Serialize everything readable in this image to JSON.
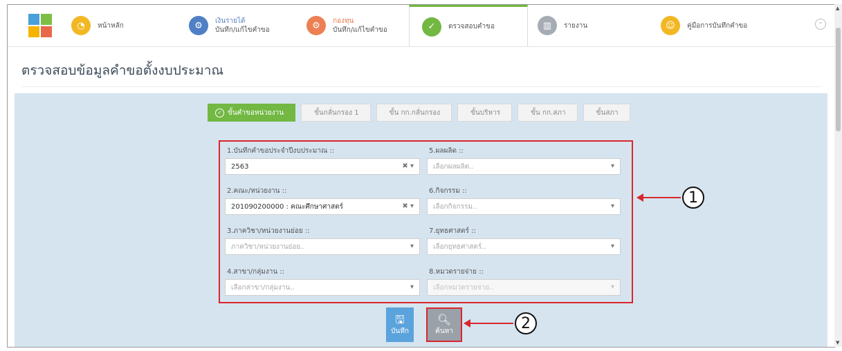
{
  "nav": {
    "items": [
      {
        "line1": "หน้าหลัก",
        "line2": ""
      },
      {
        "line1": "เงินรายได้",
        "line2": "บันทึก/แก้ไขคำขอ"
      },
      {
        "line1": "กองทุน",
        "line2": "บันทึก/แก้ไขคำขอ"
      },
      {
        "line1": "ตรวจสอบคำขอ",
        "line2": ""
      },
      {
        "line1": "รายงาน",
        "line2": ""
      },
      {
        "line1": "คู่มือการบันทึกคำขอ",
        "line2": ""
      }
    ],
    "collapse_glyph": "⌃"
  },
  "page": {
    "title": "ตรวจสอบข้อมูลคำขอตั้งงบประมาณ"
  },
  "steps": [
    "ขั้นคำขอหน่วยงาน",
    "ขั้นกลั่นกรอง 1",
    "ขั้น กก.กลั่นกรอง",
    "ขั้นบริหาร",
    "ขั้น กก.สภา",
    "ขั้นสภา"
  ],
  "form": {
    "f1": {
      "label": "1.บันทึกคำขอประจำปีงบประมาณ ::",
      "value": "2563"
    },
    "f2": {
      "label": "2.คณะ/หน่วยงาน ::",
      "value": "201090200000 : คณะศึกษาศาสตร์"
    },
    "f3": {
      "label": "3.ภาควิชา/หน่วยงานย่อย ::",
      "placeholder": "ภาควิชา/หน่วยงานย่อย.."
    },
    "f4": {
      "label": "4.สาขา/กลุ่มงาน ::",
      "placeholder": "เลือกสาขา/กลุ่มงาน.."
    },
    "f5": {
      "label": "5.ผลผลิต ::",
      "placeholder": "เลือกผลผลิต.."
    },
    "f6": {
      "label": "6.กิจกรรม ::",
      "placeholder": "เลือกกิจกรรม.."
    },
    "f7": {
      "label": "7.ยุทธศาสตร์ ::",
      "placeholder": "เลือกยุทธศาสตร์.."
    },
    "f8": {
      "label": "8.หมวดรายจ่าย ::",
      "placeholder": "เลือกหมวดรายจ่าย.."
    }
  },
  "buttons": {
    "save": "บันทึก",
    "search": "ค้นหา"
  },
  "annotations": {
    "one": "1",
    "two": "2"
  },
  "colors": {
    "active_green": "#72b843",
    "panel_bg": "#d6e4f0",
    "highlight_red": "#d9262c",
    "save_blue": "#5ba3dc"
  }
}
